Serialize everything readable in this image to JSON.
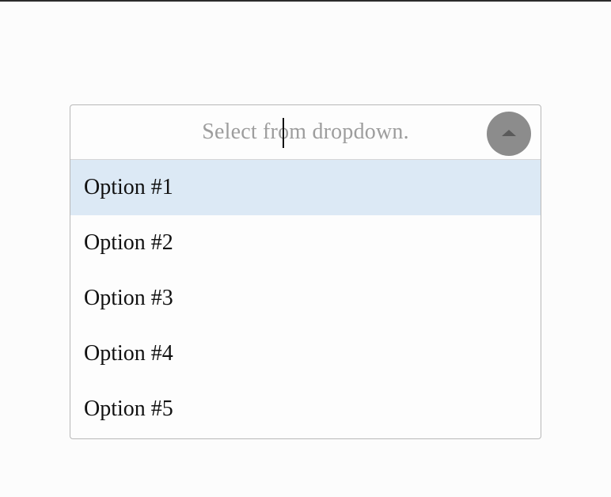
{
  "dropdown": {
    "placeholder": "Select from dropdown.",
    "toggle_icon": "caret-up-icon",
    "expanded": true,
    "highlighted_index": 0,
    "options": [
      {
        "label": "Option #1"
      },
      {
        "label": "Option #2"
      },
      {
        "label": "Option #3"
      },
      {
        "label": "Option #4"
      },
      {
        "label": "Option #5"
      }
    ]
  },
  "colors": {
    "highlight": "#dce9f5",
    "toggle": "#8c8c8c",
    "border": "#b8b8b8"
  }
}
